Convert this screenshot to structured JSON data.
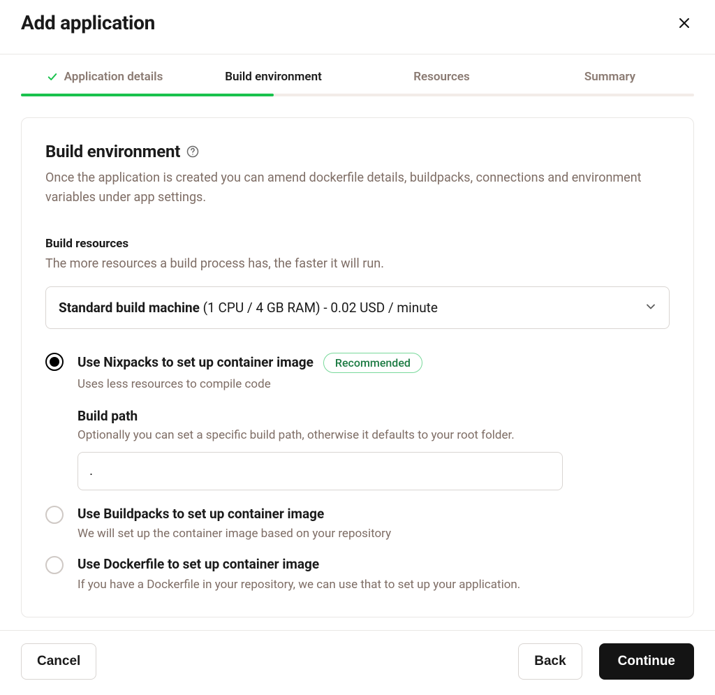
{
  "modal": {
    "title": "Add application"
  },
  "steps": {
    "items": [
      {
        "label": "Application details"
      },
      {
        "label": "Build environment"
      },
      {
        "label": "Resources"
      },
      {
        "label": "Summary"
      }
    ]
  },
  "section": {
    "title": "Build environment",
    "description": "Once the application is created you can amend dockerfile details, buildpacks, connections and environment variables under app settings."
  },
  "build_resources": {
    "label": "Build resources",
    "description": "The more resources a build process has, the faster it will run.",
    "select_strong": "Standard build machine",
    "select_rest": " (1 CPU / 4 GB RAM) - 0.02 USD / minute"
  },
  "options": {
    "nixpacks": {
      "title": "Use Nixpacks to set up container image",
      "subtitle": "Uses less resources to compile code",
      "badge": "Recommended",
      "build_path_label": "Build path",
      "build_path_desc": "Optionally you can set a specific build path, otherwise it defaults to your root folder.",
      "build_path_value": "."
    },
    "buildpacks": {
      "title": "Use Buildpacks to set up container image",
      "subtitle": "We will set up the container image based on your repository"
    },
    "dockerfile": {
      "title": "Use Dockerfile to set up container image",
      "subtitle": "If you have a Dockerfile in your repository, we can use that to set up your application."
    }
  },
  "footer": {
    "cancel": "Cancel",
    "back": "Back",
    "continue": "Continue"
  }
}
